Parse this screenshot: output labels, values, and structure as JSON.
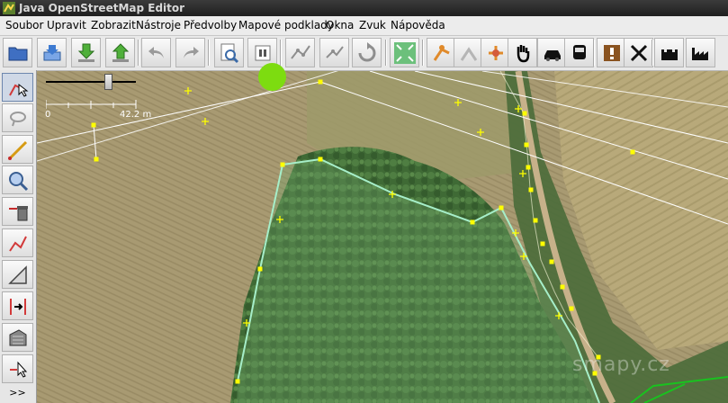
{
  "window": {
    "title": "Java OpenStreetMap Editor"
  },
  "menu": {
    "items": [
      "Soubor",
      "Upravit",
      "Zobrazit",
      "Nástroje",
      "Předvolby",
      "Mapové podklady",
      "Okna",
      "Zvuk",
      "Nápověda"
    ]
  },
  "toolbar": {
    "buttons": [
      "open-file",
      "download",
      "upload",
      "undo",
      "redo",
      "preferences",
      "image-preview",
      "split",
      "move",
      "refresh",
      "zoom-to-fit",
      "walker-1",
      "walker-2",
      "walker-3",
      "hand",
      "car",
      "bus",
      "warning",
      "crossing",
      "castle",
      "factory"
    ]
  },
  "sidebar": {
    "tools": [
      "select",
      "lasso",
      "draw",
      "zoom",
      "delete",
      "combine-way",
      "measure",
      "split-way",
      "building",
      "pointer"
    ],
    "more_label": ">>"
  },
  "map": {
    "scale": {
      "start_label": "0",
      "end_label": "42.2 m"
    },
    "watermark": "smapy.cz"
  },
  "colors": {
    "selected_area": "#a6eec9",
    "node": "#ffff00",
    "way": "#ffffff",
    "cursor": "#7ddc10"
  }
}
